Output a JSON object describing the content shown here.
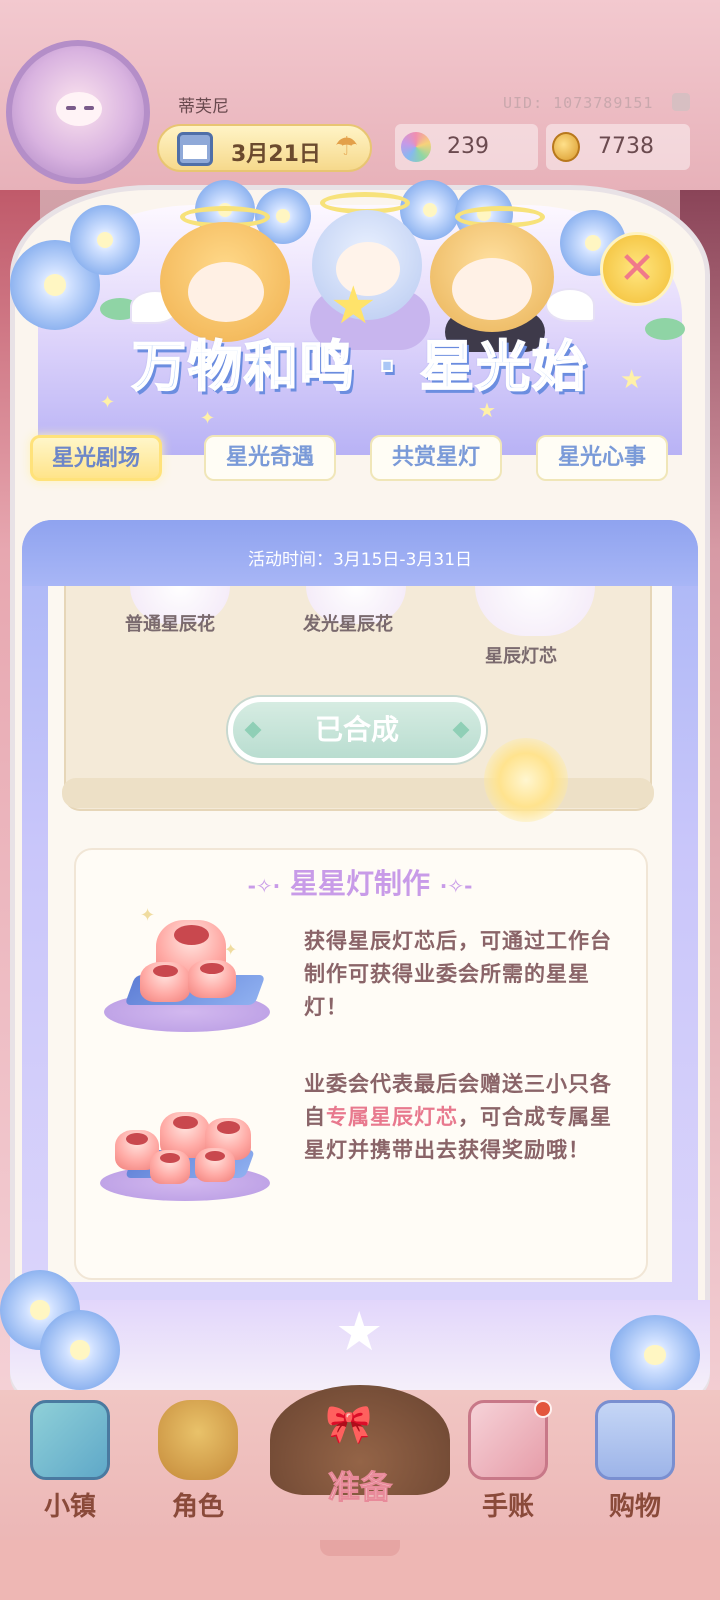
{
  "header": {
    "player_name": "蒂芙尼",
    "uid": "UID: 1073789151",
    "date": "3月21日",
    "gems": "239",
    "coins": "7738"
  },
  "event": {
    "title": "万物和鸣 · 星光始",
    "tabs": [
      {
        "label": "星光剧场",
        "active": true
      },
      {
        "label": "星光奇遇",
        "active": false
      },
      {
        "label": "共赏星灯",
        "active": false
      },
      {
        "label": "星光心事",
        "active": false
      }
    ],
    "period": "活动时间：3月15日-3月31日"
  },
  "crafting": {
    "materials": [
      "普通星辰花",
      "发光星辰花",
      "星辰灯芯"
    ],
    "button_label": "已合成"
  },
  "info": {
    "title": "星星灯制作",
    "paragraph1": "获得星辰灯芯后，可通过工作台制作可获得业委会所需的星星灯！",
    "paragraph2_prefix": "业委会代表最后会赠送三小只各自",
    "paragraph2_highlight": "专属星辰灯芯",
    "paragraph2_suffix": "，可合成专属星星灯并携带出去获得奖励哦！"
  },
  "nav": {
    "items": [
      {
        "label": "小镇",
        "icon": "map-icon"
      },
      {
        "label": "角色",
        "icon": "character-icon"
      },
      {
        "label": "准备",
        "icon": "hat-icon"
      },
      {
        "label": "手账",
        "icon": "notebook-icon"
      },
      {
        "label": "购物",
        "icon": "shopping-bag-icon"
      }
    ]
  },
  "colors": {
    "accent_blue": "#7a9ad8",
    "title_purple": "#c89be8",
    "highlight_pink": "#e8798e",
    "badge_red": "#e3563d"
  }
}
